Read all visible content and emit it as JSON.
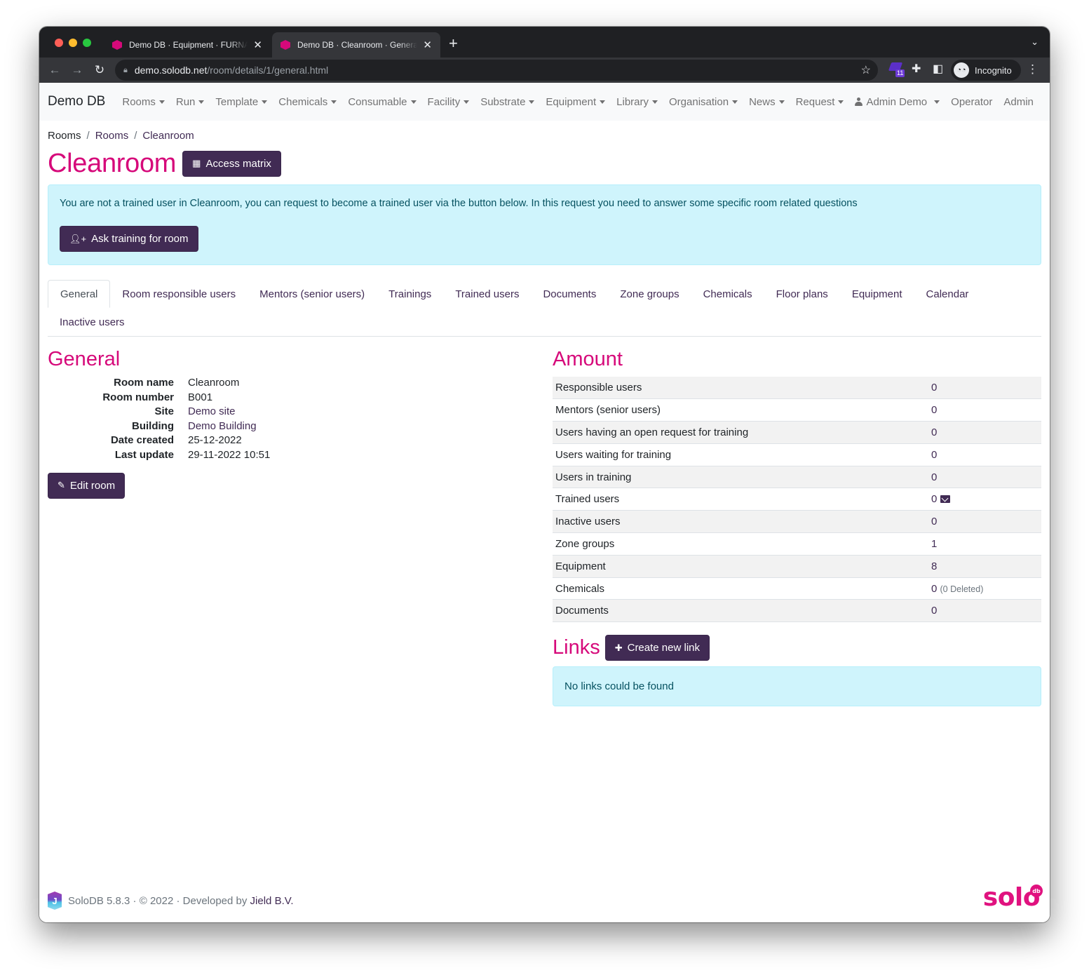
{
  "browser": {
    "tabs": [
      {
        "title": "Demo DB · Equipment · FURNACE",
        "active": false
      },
      {
        "title": "Demo DB · Cleanroom · General",
        "active": true
      }
    ],
    "new_tab_label": "+",
    "url_host": "demo.solodb.net",
    "url_path": "/room/details/1/general.html",
    "extension_badge": "11",
    "profile_label": "Incognito"
  },
  "nav": {
    "brand": "Demo DB",
    "items": [
      {
        "label": "Rooms",
        "dropdown": true
      },
      {
        "label": "Run",
        "dropdown": true
      },
      {
        "label": "Template",
        "dropdown": true
      },
      {
        "label": "Chemicals",
        "dropdown": true
      },
      {
        "label": "Consumable",
        "dropdown": true
      },
      {
        "label": "Facility",
        "dropdown": true
      },
      {
        "label": "Substrate",
        "dropdown": true
      },
      {
        "label": "Equipment",
        "dropdown": true
      },
      {
        "label": "Library",
        "dropdown": true
      },
      {
        "label": "Organisation",
        "dropdown": true
      },
      {
        "label": "News",
        "dropdown": true
      },
      {
        "label": "Request",
        "dropdown": true
      }
    ],
    "user_label": "Admin Demo",
    "operator_label": "Operator",
    "admin_label": "Admin"
  },
  "breadcrumb": [
    "Rooms",
    "Rooms",
    "Cleanroom"
  ],
  "page": {
    "title": "Cleanroom",
    "access_matrix_label": "Access matrix"
  },
  "training_alert": {
    "message": "You are not a trained user in Cleanroom, you can request to become a trained user via the button below. In this request you need to answer some specific room related questions",
    "button_label": "Ask training for room"
  },
  "tabs": [
    {
      "label": "General",
      "active": true
    },
    {
      "label": "Room responsible users"
    },
    {
      "label": "Mentors (senior users)"
    },
    {
      "label": "Trainings"
    },
    {
      "label": "Trained users"
    },
    {
      "label": "Documents"
    },
    {
      "label": "Zone groups"
    },
    {
      "label": "Chemicals"
    },
    {
      "label": "Floor plans"
    },
    {
      "label": "Equipment"
    },
    {
      "label": "Calendar"
    },
    {
      "label": "Inactive users"
    }
  ],
  "general": {
    "title": "General",
    "fields": [
      {
        "label": "Room name",
        "value": "Cleanroom",
        "link": false
      },
      {
        "label": "Room number",
        "value": "B001",
        "link": false
      },
      {
        "label": "Site",
        "value": "Demo site",
        "link": true
      },
      {
        "label": "Building",
        "value": "Demo Building",
        "link": true
      },
      {
        "label": "Date created",
        "value": "25-12-2022",
        "link": false
      },
      {
        "label": "Last update",
        "value": "29-11-2022 10:51",
        "link": false
      }
    ],
    "edit_label": "Edit room"
  },
  "amount": {
    "title": "Amount",
    "rows": [
      {
        "label": "Responsible users",
        "value": "0"
      },
      {
        "label": "Mentors (senior users)",
        "value": "0"
      },
      {
        "label": "Users having an open request for training",
        "value": "0"
      },
      {
        "label": "Users waiting for training",
        "value": "0"
      },
      {
        "label": "Users in training",
        "value": "0"
      },
      {
        "label": "Trained users",
        "value": "0",
        "icon": "envelope-icon"
      },
      {
        "label": "Inactive users",
        "value": "0"
      },
      {
        "label": "Zone groups",
        "value": "1"
      },
      {
        "label": "Equipment",
        "value": "8"
      },
      {
        "label": "Chemicals",
        "value": "0",
        "note": "(0 Deleted)"
      },
      {
        "label": "Documents",
        "value": "0"
      }
    ]
  },
  "links": {
    "title": "Links",
    "create_label": "Create new link",
    "empty_message": "No links could be found"
  },
  "footer": {
    "text": "SoloDB 5.8.3 · © 2022 · Developed by ",
    "developer": "Jield B.V.",
    "logo_text": "solo",
    "logo_badge": "db"
  },
  "colors": {
    "brand_pink": "#d6097a",
    "button_purple": "#412b54",
    "alert_bg": "#cff4fc"
  }
}
